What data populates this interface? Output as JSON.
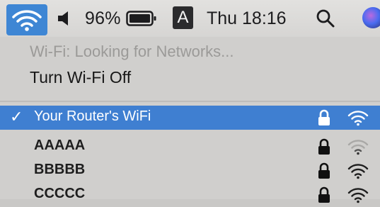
{
  "menubar": {
    "battery_percent": "96%",
    "input_source": "A",
    "clock": "Thu 18:16",
    "icons": [
      "wifi-icon",
      "speaker-icon",
      "battery-icon",
      "search-icon",
      "siri-icon"
    ]
  },
  "wifi_menu": {
    "status": "Wi-Fi: Looking for Networks...",
    "toggle_label": "Turn Wi-Fi Off",
    "networks": [
      {
        "name": "Your Router's WiFi",
        "selected": true,
        "locked": true,
        "signal": "full"
      },
      {
        "name": "AAAAA",
        "selected": false,
        "locked": true,
        "signal": "weak"
      },
      {
        "name": "BBBBB",
        "selected": false,
        "locked": true,
        "signal": "full"
      },
      {
        "name": "CCCCC",
        "selected": false,
        "locked": true,
        "signal": "full"
      }
    ],
    "checkmark": "✓"
  },
  "colors": {
    "selection": "#3f7fd1",
    "menubar_active": "#3e86d4"
  }
}
